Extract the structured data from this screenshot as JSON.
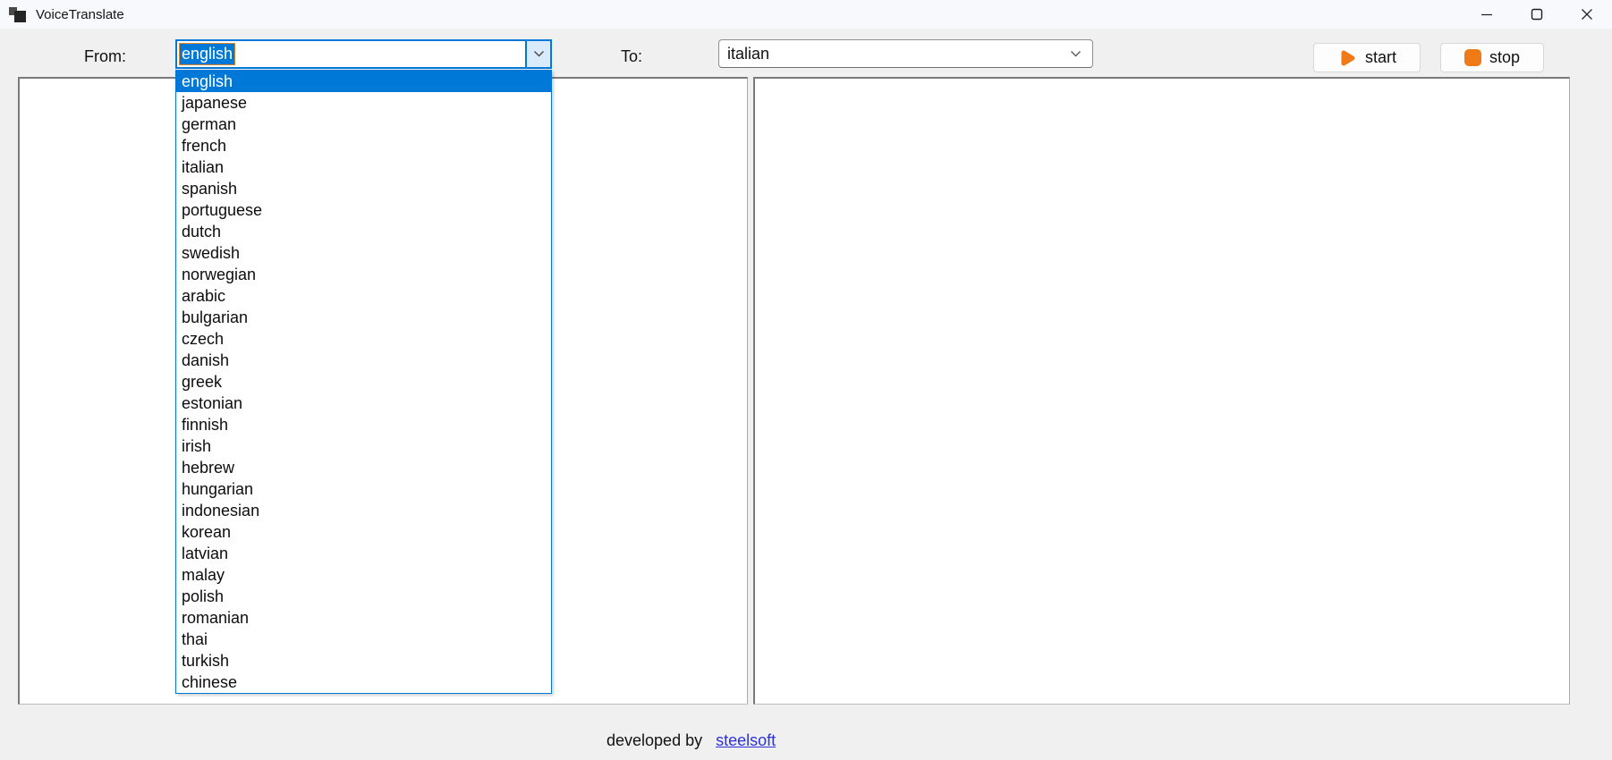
{
  "window": {
    "title": "VoiceTranslate"
  },
  "toolbar": {
    "from_label": "From:",
    "from_value": "english",
    "to_label": "To:",
    "to_value": "italian",
    "start_label": "start",
    "stop_label": "stop"
  },
  "dropdown": {
    "selected": "english",
    "items": [
      "english",
      "japanese",
      "german",
      "french",
      "italian",
      "spanish",
      "portuguese",
      "dutch",
      "swedish",
      "norwegian",
      "arabic",
      "bulgarian",
      "czech",
      "danish",
      "greek",
      "estonian",
      "finnish",
      "irish",
      "hebrew",
      "hungarian",
      "indonesian",
      "korean",
      "latvian",
      "malay",
      "polish",
      "romanian",
      "thai",
      "turkish",
      "chinese"
    ]
  },
  "footer": {
    "text": "developed by",
    "link": "steelsoft"
  },
  "colors": {
    "accent_orange": "#F07B16",
    "selection_blue": "#0078D7",
    "link_blue": "#2B32DB"
  },
  "icons": {
    "app": "window-stack-icon",
    "minimize": "minimize-icon",
    "maximize": "maximize-icon",
    "close": "close-icon",
    "from_chevron": "chevron-down-icon",
    "to_chevron": "chevron-down-icon",
    "start": "play-icon",
    "stop": "stop-icon"
  }
}
